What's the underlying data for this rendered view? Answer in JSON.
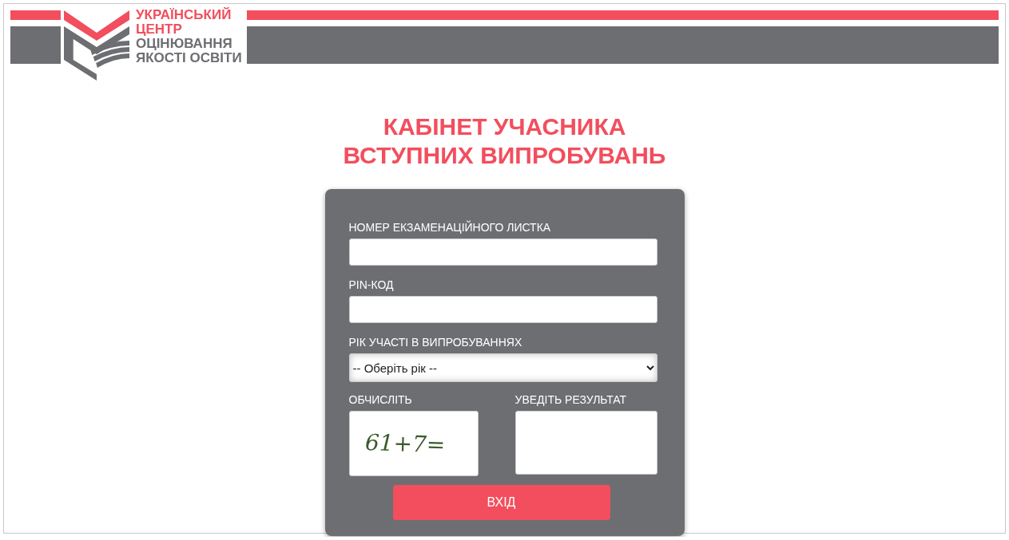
{
  "logo": {
    "lines": [
      {
        "text": "УКРАЇНСЬКИЙ",
        "color": "#f24e5e"
      },
      {
        "text": "ЦЕНТР",
        "color": "#f24e5e"
      },
      {
        "text": "ОЦІНЮВАННЯ",
        "color": "#6d6e72"
      },
      {
        "text": "ЯКОСТІ ОСВІТИ",
        "color": "#6d6e72"
      }
    ]
  },
  "title": [
    "КАБІНЕТ УЧАСНИКА",
    "ВСТУПНИХ ВИПРОБУВАНЬ"
  ],
  "form": {
    "fields": [
      {
        "kind": "text",
        "label": "НОМЕР ЕКЗАМЕНАЦІЙНОГО ЛИСТКА"
      },
      {
        "kind": "text",
        "label": "PIN-КОД"
      },
      {
        "kind": "select",
        "label": "РІК УЧАСТІ В ВИПРОБУВАННЯХ",
        "value": "-- Оберіть рік --"
      }
    ],
    "captcha": {
      "label": "ОБЧИСЛІТЬ",
      "expression": "61+7="
    },
    "result": {
      "label": "УВЕДІТЬ РЕЗУЛЬТАТ"
    },
    "submit": "ВХІД"
  }
}
